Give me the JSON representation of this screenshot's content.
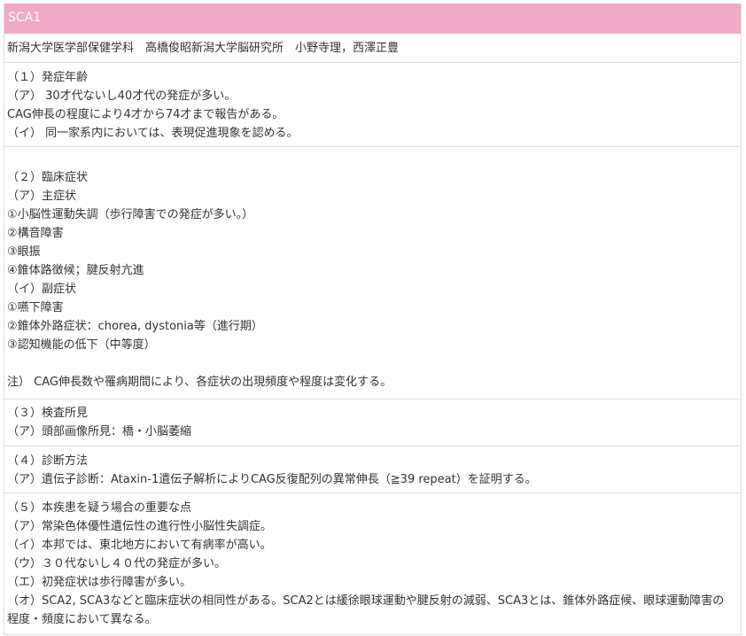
{
  "header": {
    "title": "SCA1"
  },
  "authors": "新潟大学医学部保健学科　高橋俊昭新潟大学脳研究所　小野寺理，西澤正豊",
  "s1": {
    "lines": [
      "（１）発症年齢",
      "（ア） 30才代ないし40才代の発症が多い。",
      "CAG伸長の程度により4才から74才まで報告がある。",
      "（イ） 同一家系内においては、表現促進現象を認める。"
    ]
  },
  "s2": {
    "lines": [
      "（２）臨床症状",
      "（ア）主症状",
      "①小脳性運動失調（歩行障害での発症が多い。）",
      "②構音障害",
      "③眼振",
      "④錐体路徴候；腱反射亢進",
      "（イ）副症状",
      "①嚥下障害",
      "②錐体外路症状：chorea, dystonia等（進行期）",
      "③認知機能の低下（中等度）"
    ],
    "note": "注） CAG伸長数や罹病期間により、各症状の出現頻度や程度は変化する。"
  },
  "s3": {
    "lines": [
      "（３）検査所見",
      "（ア）頭部画像所見：橋・小脳萎縮"
    ]
  },
  "s4": {
    "lines": [
      "（４）診断方法",
      "（ア）遺伝子診断：Ataxin-1遺伝子解析によりCAG反復配列の異常伸長（≧39 repeat）を証明する。"
    ]
  },
  "s5": {
    "lines": [
      "（５）本疾患を疑う場合の重要な点",
      "（ア）常染色体優性遺伝性の進行性小脳性失調症。",
      "（イ）本邦では、東北地方において有病率が高い。",
      "（ウ）３０代ないし４０代の発症が多い。",
      "（エ）初発症状は歩行障害が多い。",
      "（オ）SCA2, SCA3などと臨床症状の相同性がある。SCA2とは緩徐眼球運動や腱反射の減弱、SCA3とは、錐体外路症候、眼球運動障害の程度・頻度において異なる。"
    ]
  }
}
